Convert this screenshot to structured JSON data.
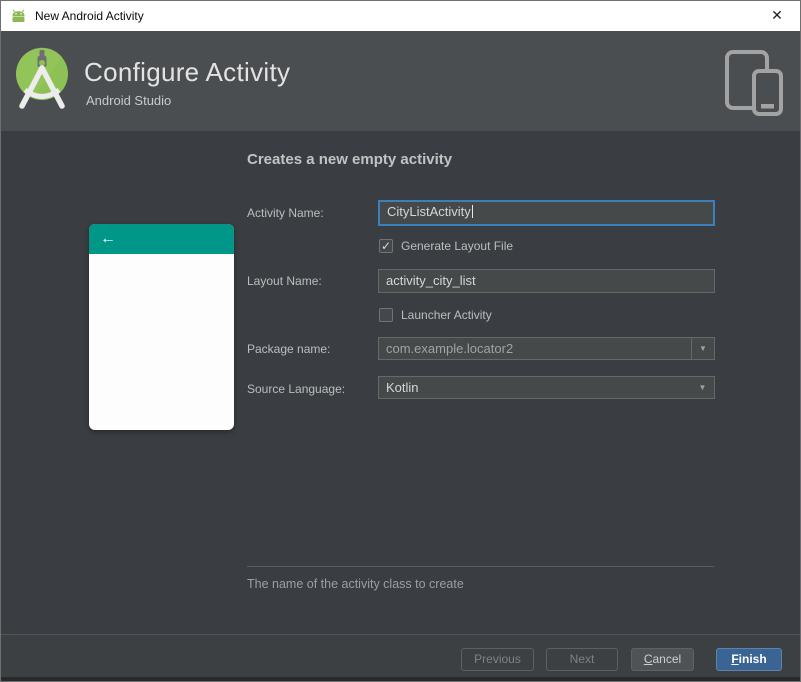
{
  "window": {
    "title": "New Android Activity"
  },
  "icons": {
    "close": "✕",
    "check": "✓",
    "dropdown_arrow": "▼",
    "back_arrow": "←"
  },
  "header": {
    "title": "Configure Activity",
    "subtitle": "Android Studio"
  },
  "main": {
    "heading": "Creates a new empty activity",
    "fields": {
      "activity_name": {
        "label": "Activity Name:",
        "value": "CityListActivity",
        "focused": true
      },
      "generate_layout": {
        "label": "Generate Layout File",
        "checked": true
      },
      "layout_name": {
        "label": "Layout Name:",
        "value": "activity_city_list"
      },
      "launcher_activity": {
        "label": "Launcher Activity",
        "checked": false
      },
      "package_name": {
        "label": "Package name:",
        "value": "com.example.locator2"
      },
      "source_language": {
        "label": "Source Language:",
        "value": "Kotlin"
      }
    },
    "hint": "The name of the activity class to create"
  },
  "footer": {
    "buttons": [
      {
        "label": "Previous",
        "state": "disabled"
      },
      {
        "label": "Next",
        "state": "disabled"
      },
      {
        "label": "Cancel",
        "state": "normal"
      },
      {
        "label": "Finish",
        "state": "primary"
      }
    ]
  },
  "colors": {
    "titlebar_bg": "#ffffff",
    "header_bg": "#4b4e50",
    "body_bg": "#3a3e42",
    "input_bg": "#45494a",
    "input_border": "#646a6c",
    "focus_border": "#3d7ebd",
    "preview_accent_teal": "#009688",
    "primary_button_blue": "#3a6494",
    "logo_green": "#8ec155"
  }
}
